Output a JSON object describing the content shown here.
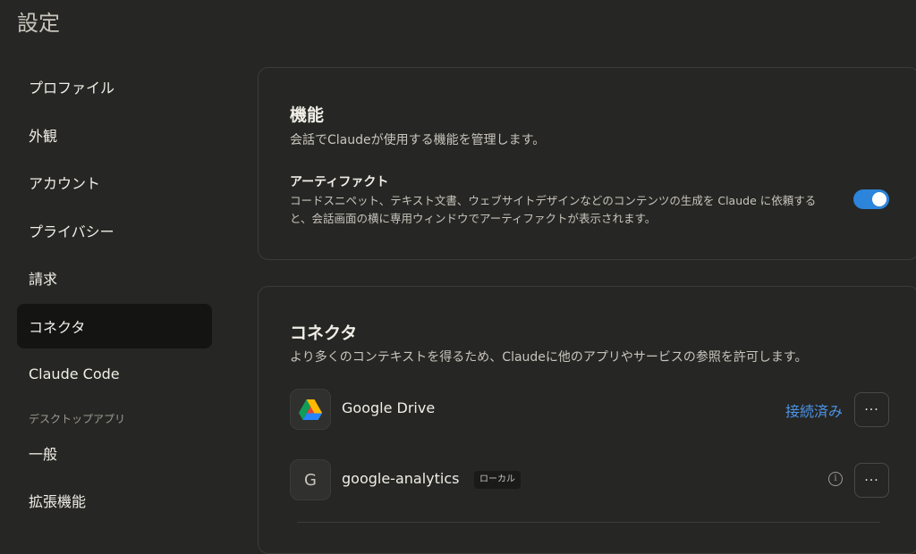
{
  "page": {
    "title": "設定"
  },
  "sidebar": {
    "items": [
      {
        "label": "プロファイル"
      },
      {
        "label": "外観"
      },
      {
        "label": "アカウント"
      },
      {
        "label": "プライバシー"
      },
      {
        "label": "請求"
      },
      {
        "label": "コネクタ",
        "active": true
      },
      {
        "label": "Claude Code"
      }
    ],
    "section_label": "デスクトップアプリ",
    "desktop_items": [
      {
        "label": "一般"
      },
      {
        "label": "拡張機能"
      }
    ]
  },
  "features": {
    "title": "機能",
    "subtitle": "会話でClaudeが使用する機能を管理します。",
    "artifacts": {
      "name": "アーティファクト",
      "description": "コードスニペット、テキスト文書、ウェブサイトデザインなどのコンテンツの生成を Claude に依頼すると、会話画面の横に専用ウィンドウでアーティファクトが表示されます。",
      "enabled": true
    }
  },
  "connectors": {
    "title": "コネクタ",
    "subtitle": "より多くのコンテキストを得るため、Claudeに他のアプリやサービスの参照を許可します。",
    "items": [
      {
        "name": "Google Drive",
        "icon": "google-drive-icon",
        "status": "接続済み",
        "more": "···"
      },
      {
        "name": "google-analytics",
        "icon_letter": "G",
        "badge": "ローカル",
        "info": "i",
        "more": "···"
      }
    ]
  },
  "colors": {
    "background": "#262624",
    "accent": "#2c84db",
    "link": "#4c94e6",
    "active_nav": "#141413"
  }
}
